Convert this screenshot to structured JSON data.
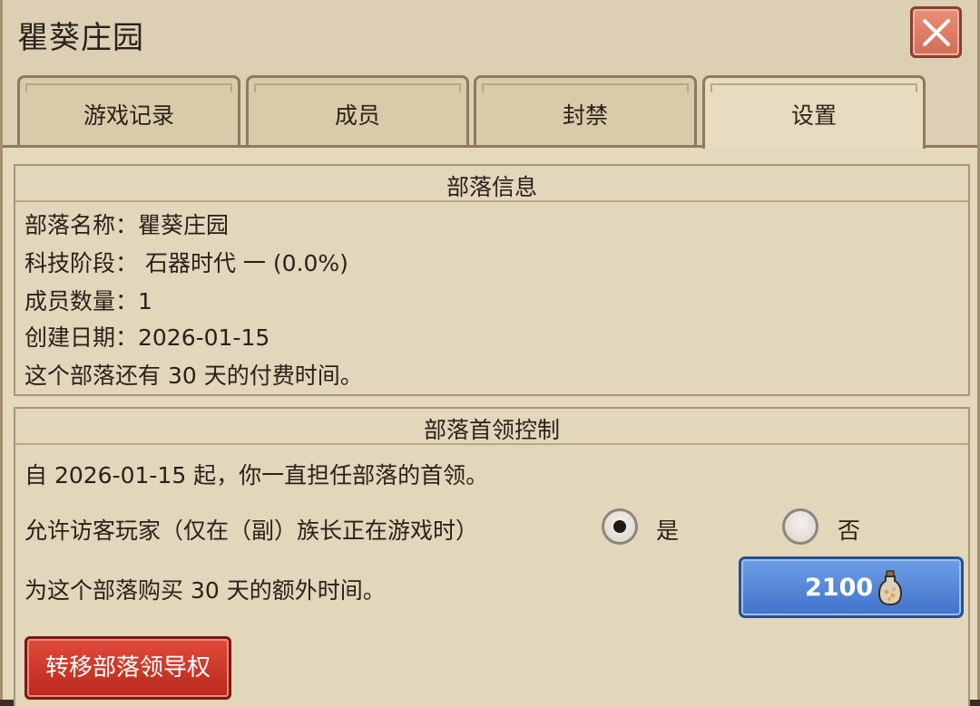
{
  "window": {
    "title": "瞿葵庄园"
  },
  "tabs": [
    {
      "label": "游戏记录",
      "active": false
    },
    {
      "label": "成员",
      "active": false
    },
    {
      "label": "封禁",
      "active": false
    },
    {
      "label": "设置",
      "active": true
    }
  ],
  "tribe_info": {
    "title": "部落信息",
    "lines": [
      "部落名称：瞿葵庄园",
      "科技阶段： 石器时代 一 (0.0%)",
      "成员数量：1",
      "创建日期：2026-01-15",
      "这个部落还有 30 天的付费时间。"
    ]
  },
  "leader_control": {
    "title": "部落首领控制",
    "since_text": "自 2026-01-15 起，你一直担任部落的首领。",
    "allow_visitors": {
      "label": "允许访客玩家（仅在（副）族长正在游戏时）",
      "yes_label": "是",
      "no_label": "否",
      "selected": "yes"
    },
    "buy_time": {
      "text": "为这个部落购买 30 天的额外时间。",
      "price": "2100",
      "currency_icon": "potion-bottle-icon"
    },
    "transfer_button": "转移部落领导权"
  },
  "colors": {
    "panel_bg": "#e2d6bb",
    "blue_button": "#4f84d6",
    "red_button": "#c8332a",
    "close_button": "#d36e58"
  }
}
